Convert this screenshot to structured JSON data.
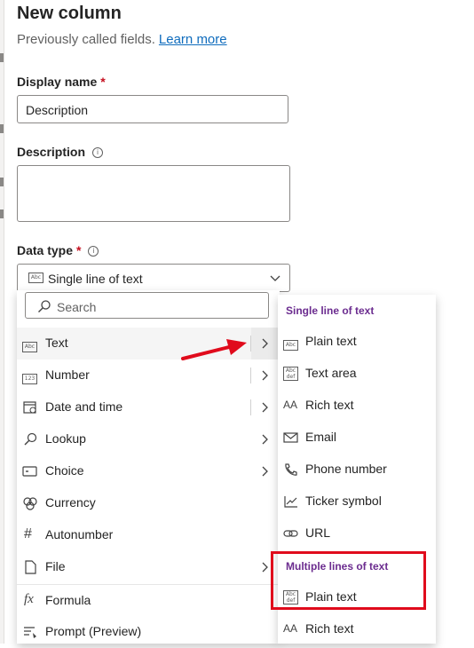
{
  "panel": {
    "title": "New column",
    "subtitle": "Previously called fields.",
    "learn_more": "Learn more"
  },
  "display_name": {
    "label": "Display name",
    "required": "*",
    "value": "Description"
  },
  "description": {
    "label": "Description",
    "value": ""
  },
  "data_type": {
    "label": "Data type",
    "required": "*",
    "selected": "Single line of text"
  },
  "menu": {
    "search_placeholder": "Search",
    "items": [
      {
        "label": "Text",
        "icon": "text-abc-icon",
        "has_submenu": true
      },
      {
        "label": "Number",
        "icon": "number-123-icon",
        "has_submenu": true
      },
      {
        "label": "Date and time",
        "icon": "calendar-icon",
        "has_submenu": true
      },
      {
        "label": "Lookup",
        "icon": "search-icon",
        "has_submenu": true
      },
      {
        "label": "Choice",
        "icon": "choice-icon",
        "has_submenu": true
      },
      {
        "label": "Currency",
        "icon": "currency-icon",
        "has_submenu": false
      },
      {
        "label": "Autonumber",
        "icon": "hash-icon",
        "has_submenu": false
      },
      {
        "label": "File",
        "icon": "file-icon",
        "has_submenu": true
      },
      {
        "label": "Formula",
        "icon": "fx-icon",
        "has_submenu": false
      },
      {
        "label": "Prompt (Preview)",
        "icon": "prompt-icon",
        "has_submenu": false
      }
    ]
  },
  "submenu": {
    "group1": "Single line of text",
    "group1_items": [
      {
        "label": "Plain text",
        "icon": "text-abc-icon"
      },
      {
        "label": "Text area",
        "icon": "text-area-icon"
      },
      {
        "label": "Rich text",
        "icon": "rich-text-icon"
      },
      {
        "label": "Email",
        "icon": "mail-icon"
      },
      {
        "label": "Phone number",
        "icon": "phone-icon"
      },
      {
        "label": "Ticker symbol",
        "icon": "chart-line-icon"
      },
      {
        "label": "URL",
        "icon": "link-icon"
      }
    ],
    "group2": "Multiple lines of text",
    "group2_items": [
      {
        "label": "Plain text",
        "icon": "text-area-icon"
      },
      {
        "label": "Rich text",
        "icon": "rich-text-icon"
      }
    ]
  },
  "colors": {
    "accent": "#6b2c8f",
    "link": "#0f6cbd",
    "highlight": "#e00b1c"
  }
}
